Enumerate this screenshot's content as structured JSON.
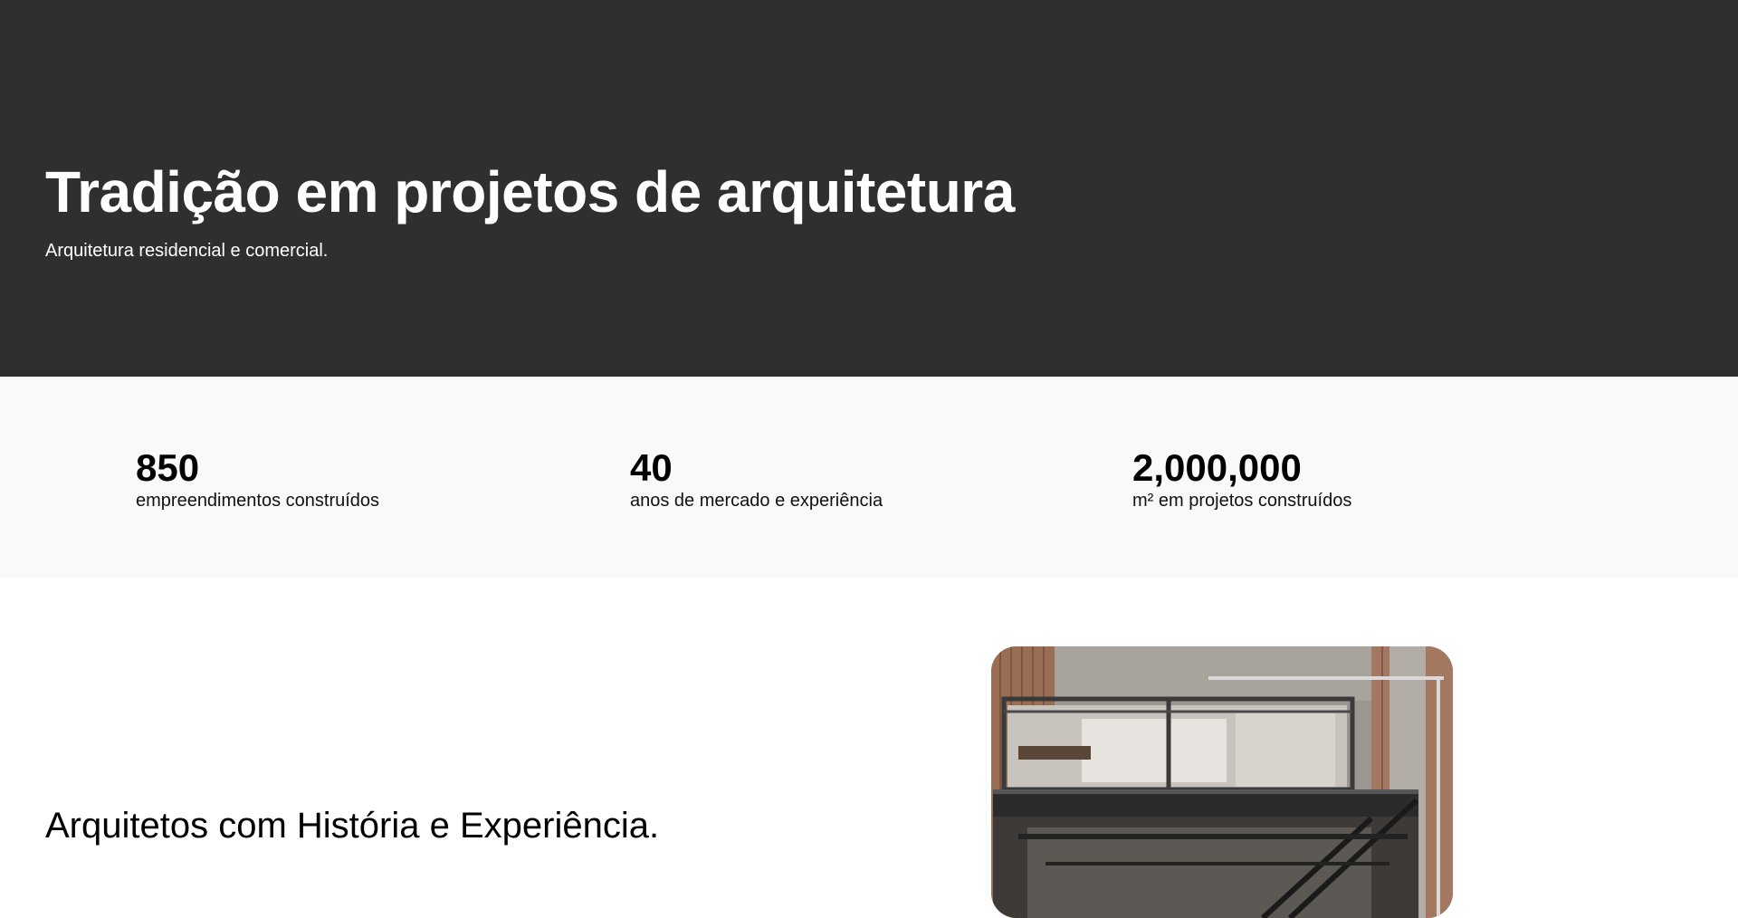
{
  "hero": {
    "title": "Tradição em projetos de arquitetura",
    "subtitle": "Arquitetura residencial e comercial."
  },
  "stats": [
    {
      "value": "850",
      "label": "empreendimentos construídos"
    },
    {
      "value": "40",
      "label": "anos de mercado e experiência"
    },
    {
      "value": "2,000,000",
      "label": "m² em projetos construídos"
    }
  ],
  "about": {
    "title": "Arquitetos com História e Experiência."
  },
  "colors": {
    "hero_bg": "#2f2f2f",
    "stats_bg": "#f9f9f9",
    "page_bg": "#ffffff"
  }
}
